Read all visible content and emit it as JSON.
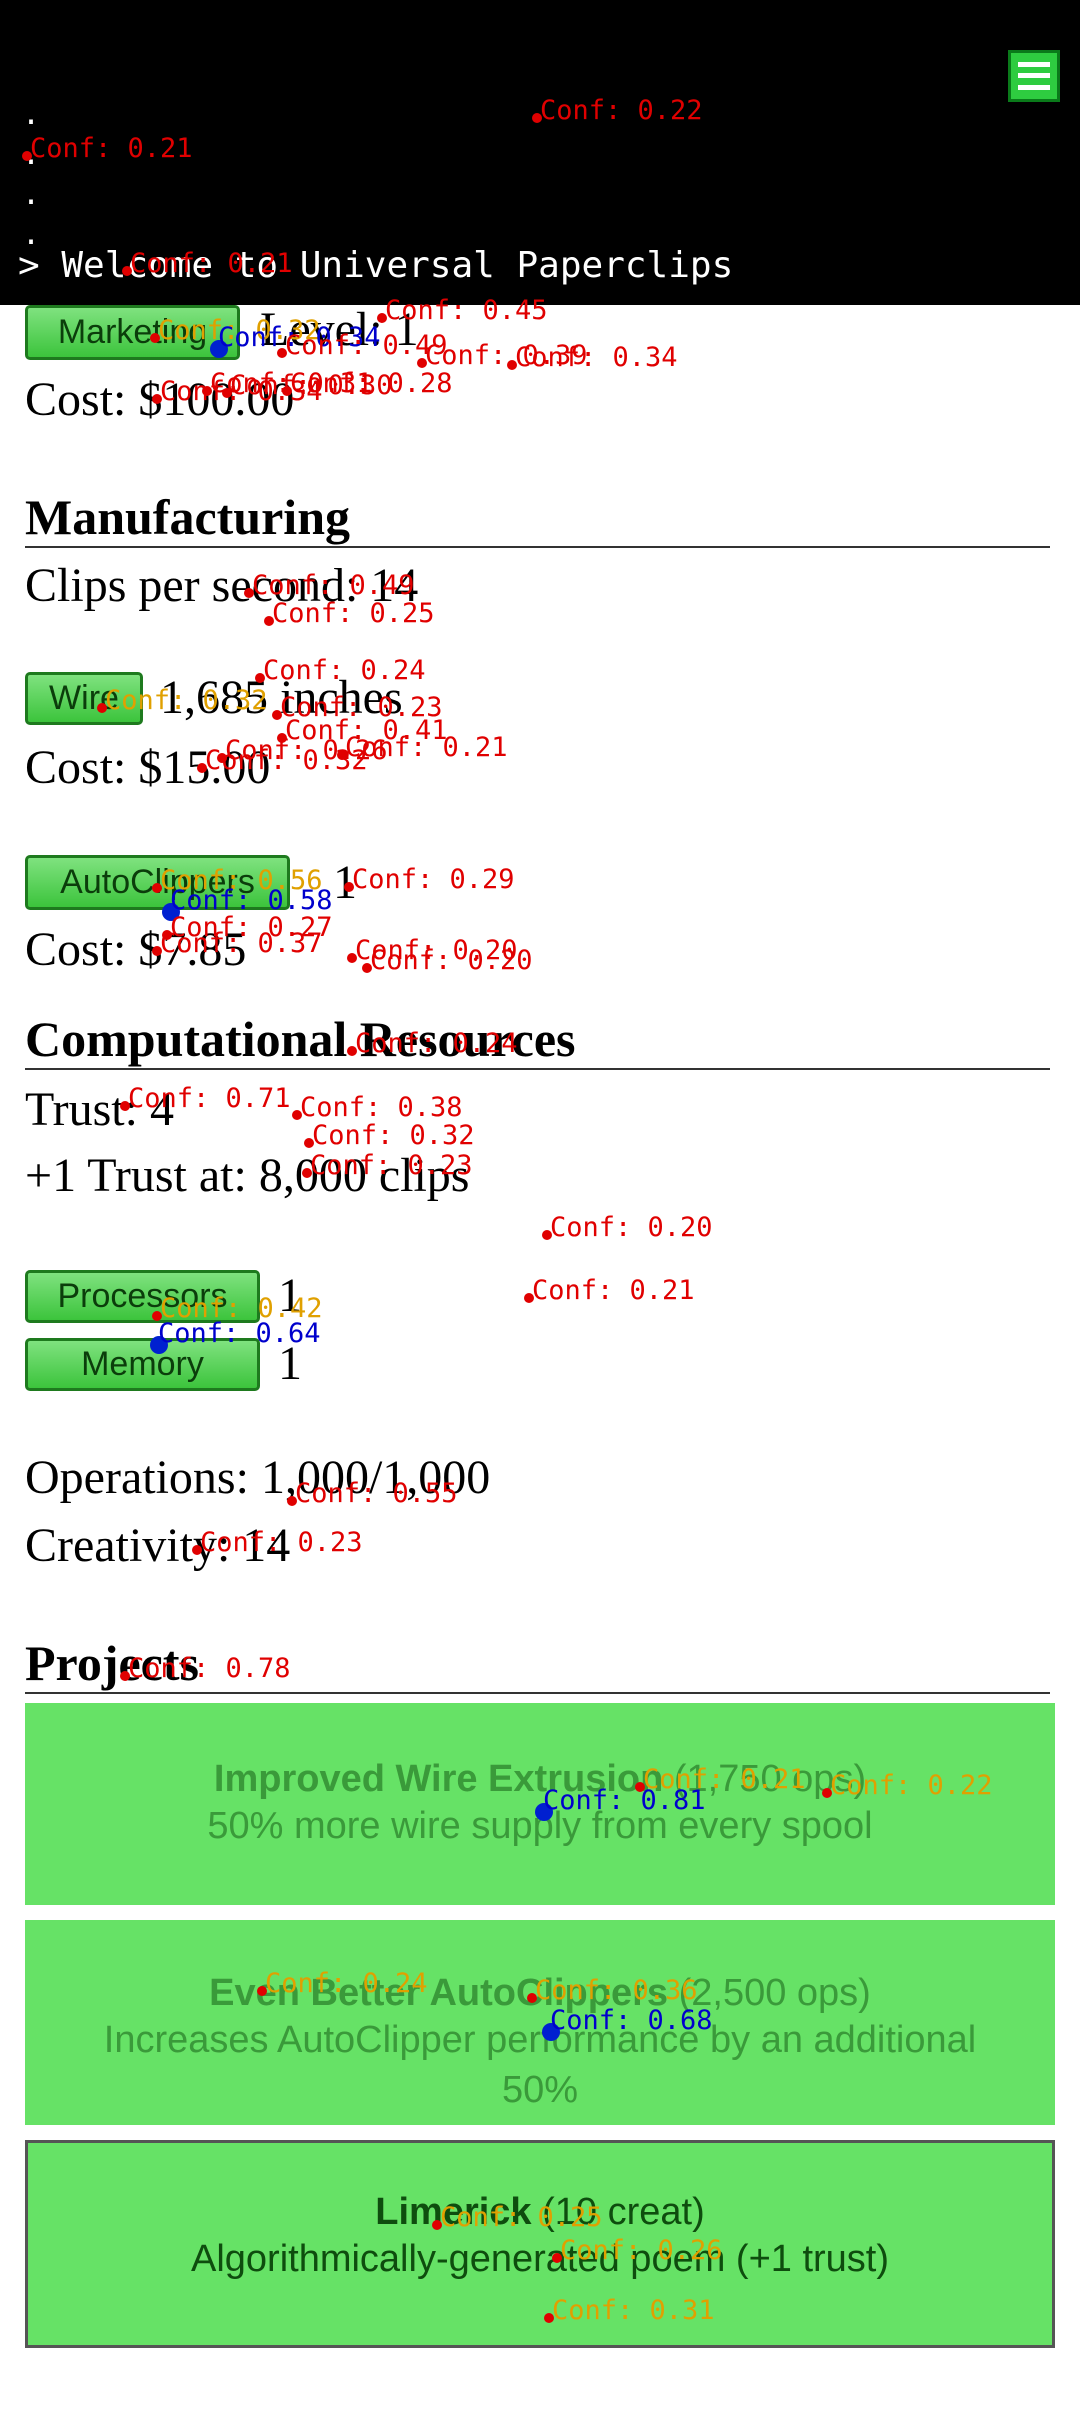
{
  "console": {
    "dots": [
      ".",
      ".",
      ".",
      "."
    ],
    "line": "> Welcome to Universal Paperclips"
  },
  "business": {
    "marketing_button": "Marketing",
    "level_text": "Level: 1",
    "cost_text": "Cost: $100.00"
  },
  "manufacturing": {
    "title": "Manufacturing",
    "clips_per_second": "Clips per second: 14",
    "wire_button": "Wire",
    "wire_amount": "1,685 inches",
    "wire_cost": "Cost: $15.00",
    "autoclippers_button": "AutoClippers",
    "autoclippers_count": "1",
    "autoclippers_cost": "Cost: $7.85"
  },
  "computational": {
    "title": "Computational Resources",
    "trust": "Trust: 4",
    "next_trust": "+1 Trust at: 8,000 clips",
    "processors_button": "Processors",
    "processors_count": "1",
    "memory_button": "Memory",
    "memory_count": "1",
    "operations": "Operations: 1,000/1,000",
    "creativity": "Creativity: 14"
  },
  "projects": {
    "title": "Projects",
    "items": [
      {
        "name": "Improved Wire Extrusion",
        "cost": " (1,750 ops)",
        "desc": "50% more wire supply from every spool"
      },
      {
        "name": "Even Better AutoClippers",
        "cost": " (2,500 ops)",
        "desc": "Increases AutoClipper performance by an additional 50%"
      },
      {
        "name": "Limerick",
        "cost": " (10 creat)",
        "desc": "Algorithmically-generated poem (+1 trust)"
      }
    ]
  },
  "overlay": {
    "labels": [
      {
        "text": "Conf: 0.22",
        "color": "red"
      },
      {
        "text": "Conf: 0.21",
        "color": "red"
      },
      {
        "text": "Conf: 0.21",
        "color": "red"
      },
      {
        "text": "Conf: 0.45",
        "color": "red"
      },
      {
        "text": "Conf: 0.32",
        "color": "orange"
      },
      {
        "text": "Conf: 0.34",
        "color": "blue"
      },
      {
        "text": "Conf: 0.49",
        "color": "red"
      },
      {
        "text": "Conf: 0.39",
        "color": "red"
      },
      {
        "text": "Conf: 0.34",
        "color": "red"
      },
      {
        "text": "Conf: 0.31",
        "color": "red"
      },
      {
        "text": "Conf: 0.28",
        "color": "red"
      },
      {
        "text": "Conf: 0.30",
        "color": "red"
      },
      {
        "text": "Conf: 0.34",
        "color": "red"
      },
      {
        "text": "Conf: 0.49",
        "color": "red"
      },
      {
        "text": "Conf: 0.25",
        "color": "red"
      },
      {
        "text": "Conf: 0.24",
        "color": "red"
      },
      {
        "text": "Conf: 0.32",
        "color": "orange"
      },
      {
        "text": "Conf: 0.23",
        "color": "red"
      },
      {
        "text": "Conf: 0.41",
        "color": "red"
      },
      {
        "text": "Conf: 0.26",
        "color": "red"
      },
      {
        "text": "Conf: 0.21",
        "color": "red"
      },
      {
        "text": "Conf: 0.32",
        "color": "red"
      },
      {
        "text": "Conf: 0.56",
        "color": "orange"
      },
      {
        "text": "Conf: 0.29",
        "color": "red"
      },
      {
        "text": "Conf: 0.58",
        "color": "blue"
      },
      {
        "text": "Conf: 0.27",
        "color": "red"
      },
      {
        "text": "Conf: 0.37",
        "color": "red"
      },
      {
        "text": "Conf: 0.20",
        "color": "red"
      },
      {
        "text": "Conf: 0.20",
        "color": "red"
      },
      {
        "text": "Conf: 0.24",
        "color": "red"
      },
      {
        "text": "Conf: 0.71",
        "color": "red"
      },
      {
        "text": "Conf: 0.38",
        "color": "red"
      },
      {
        "text": "Conf: 0.32",
        "color": "red"
      },
      {
        "text": "Conf: 0.23",
        "color": "red"
      },
      {
        "text": "Conf: 0.20",
        "color": "red"
      },
      {
        "text": "Conf: 0.21",
        "color": "red"
      },
      {
        "text": "Conf: 0.42",
        "color": "orange"
      },
      {
        "text": "Conf: 0.64",
        "color": "blue"
      },
      {
        "text": "Conf: 0.55",
        "color": "red"
      },
      {
        "text": "Conf: 0.23",
        "color": "red"
      },
      {
        "text": "Conf: 0.78",
        "color": "red"
      },
      {
        "text": "Conf: 0.21",
        "color": "orange"
      },
      {
        "text": "Conf: 0.22",
        "color": "orange"
      },
      {
        "text": "Conf: 0.81",
        "color": "blue"
      },
      {
        "text": "Conf: 0.24",
        "color": "orange"
      },
      {
        "text": "Conf: 0.36",
        "color": "orange"
      },
      {
        "text": "Conf: 0.68",
        "color": "blue"
      },
      {
        "text": "Conf: 0.25",
        "color": "orange"
      },
      {
        "text": "Conf: 0.26",
        "color": "orange"
      },
      {
        "text": "Conf: 0.31",
        "color": "orange"
      }
    ]
  }
}
